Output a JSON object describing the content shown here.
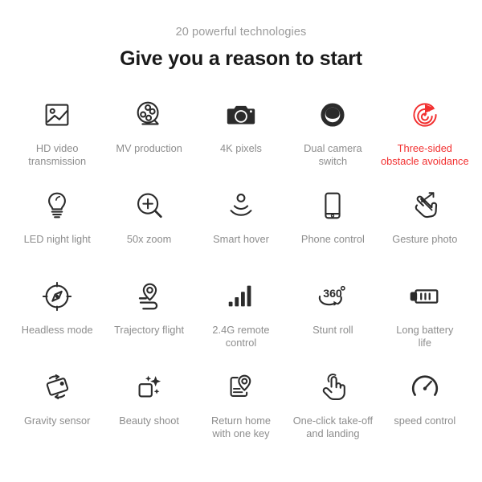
{
  "header": {
    "eyebrow": "20 powerful technologies",
    "headline": "Give you a reason to start"
  },
  "colors": {
    "text_gray": "#8d8d8d",
    "headline_black": "#1a1a1a",
    "icon_dark": "#2b2b2b",
    "highlight_red": "#f23030",
    "background": "#ffffff"
  },
  "features": [
    {
      "label": "HD video\ntransmission",
      "icon": "image-photo-icon",
      "highlight": false
    },
    {
      "label": "MV production",
      "icon": "film-reel-icon",
      "highlight": false
    },
    {
      "label": "4K pixels",
      "icon": "camera-icon",
      "highlight": false
    },
    {
      "label": "Dual camera\nswitch",
      "icon": "dual-camera-lens-icon",
      "highlight": false
    },
    {
      "label": "Three-sided\nobstacle avoidance",
      "icon": "radar-obstacle-icon",
      "highlight": true
    },
    {
      "label": "LED night light",
      "icon": "lightbulb-icon",
      "highlight": false
    },
    {
      "label": "50x zoom",
      "icon": "magnifier-plus-icon",
      "highlight": false
    },
    {
      "label": "Smart hover",
      "icon": "hover-waves-icon",
      "highlight": false
    },
    {
      "label": "Phone control",
      "icon": "smartphone-icon",
      "highlight": false
    },
    {
      "label": "Gesture photo",
      "icon": "gesture-hand-icon",
      "highlight": false
    },
    {
      "label": "Headless mode",
      "icon": "compass-icon",
      "highlight": false
    },
    {
      "label": "Trajectory flight",
      "icon": "route-pin-icon",
      "highlight": false
    },
    {
      "label": "2.4G remote\ncontrol",
      "icon": "signal-bars-icon",
      "highlight": false
    },
    {
      "label": "Stunt roll",
      "icon": "three-sixty-rotate-icon",
      "highlight": false
    },
    {
      "label": "Long battery\nlife",
      "icon": "battery-icon",
      "highlight": false
    },
    {
      "label": "Gravity sensor",
      "icon": "gravity-tilt-icon",
      "highlight": false
    },
    {
      "label": "Beauty shoot",
      "icon": "sparkle-square-icon",
      "highlight": false
    },
    {
      "label": "Return home\nwith one key",
      "icon": "map-pin-return-icon",
      "highlight": false
    },
    {
      "label": "One-click take-off\nand landing",
      "icon": "tap-hand-icon",
      "highlight": false
    },
    {
      "label": "speed control",
      "icon": "speedometer-icon",
      "highlight": false
    }
  ]
}
